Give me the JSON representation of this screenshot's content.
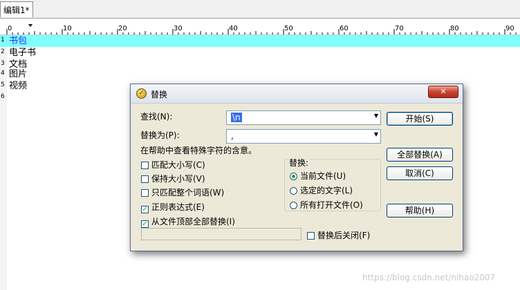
{
  "tab": {
    "label": "编辑1*"
  },
  "ruler": {
    "marks": [
      "0",
      "10",
      "20",
      "30",
      "40",
      "50",
      "60",
      "70",
      "80",
      "90"
    ]
  },
  "editor": {
    "lines": [
      {
        "num": "1",
        "text": "书包"
      },
      {
        "num": "2",
        "text": "电子书"
      },
      {
        "num": "3",
        "text": "文档"
      },
      {
        "num": "4",
        "text": "图片"
      },
      {
        "num": "5",
        "text": "视频"
      },
      {
        "num": "6",
        "text": ""
      }
    ]
  },
  "dialog": {
    "title": "替换",
    "close_label": "✕",
    "find_label": "查找(N):",
    "find_value": "\\n",
    "replace_label": "替换为(P):",
    "replace_value": ",",
    "help_text": "在帮助中查看特殊字符的含意。",
    "options": [
      {
        "label": "匹配大小写(C)",
        "checked": false
      },
      {
        "label": "保持大小写(V)",
        "checked": false
      },
      {
        "label": "只匹配整个词语(W)",
        "checked": false
      },
      {
        "label": "正则表达式(E)",
        "checked": true
      },
      {
        "label": "从文件顶部全部替换(I)",
        "checked": true
      }
    ],
    "scope": {
      "title": "替换:",
      "items": [
        {
          "label": "当前文件(U)",
          "selected": true
        },
        {
          "label": "选定的文字(L)",
          "selected": false
        },
        {
          "label": "所有打开文件(O)",
          "selected": false
        }
      ]
    },
    "close_after": {
      "label": "替换后关闭(F)",
      "checked": false
    },
    "buttons": {
      "start": "开始(S)",
      "replace_all": "全部替换(A)",
      "cancel": "取消(C)",
      "help": "帮助(H)"
    }
  },
  "watermark": "https://blog.csdn.net/nihao2007"
}
